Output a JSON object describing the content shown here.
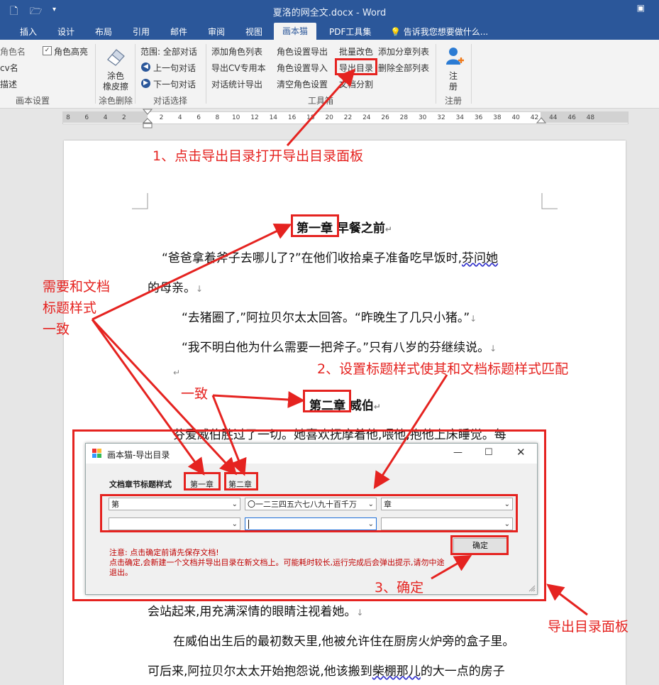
{
  "window": {
    "title": "夏洛的网全文.docx - Word",
    "quick_access": [
      "new-doc-icon",
      "open-folder-icon",
      "customize-icon"
    ]
  },
  "tabs": [
    {
      "label": "插入"
    },
    {
      "label": "设计"
    },
    {
      "label": "布局"
    },
    {
      "label": "引用"
    },
    {
      "label": "邮件"
    },
    {
      "label": "审阅"
    },
    {
      "label": "视图"
    },
    {
      "label": "画本猫",
      "active": true
    },
    {
      "label": "PDF工具集"
    }
  ],
  "tell_me": "告诉我您想要做什么...",
  "ribbon": {
    "g1": {
      "items": [
        "角色名",
        "cv名",
        "描述"
      ],
      "label": "画本设置"
    },
    "g2": {
      "role_highlight": "角色高亮",
      "role_highlight_checked": true
    },
    "g3": {
      "eraser_line1": "涂色",
      "eraser_line2": "橡皮擦",
      "label": "涂色删除"
    },
    "g4": {
      "scope": "范围: 全部对话",
      "prev": "上一句对话",
      "next": "下一句对话",
      "label": "对话选择"
    },
    "g5": {
      "col1": [
        "添加角色列表",
        "导出CV专用本",
        "对话统计导出"
      ],
      "col2": [
        "角色设置导出",
        "角色设置导入",
        "清空角色设置"
      ],
      "col3": [
        "批量改色",
        "导出目录",
        "文档分割"
      ],
      "col4": [
        "添加分章列表",
        "删除全部列表"
      ],
      "label": "工具箱"
    },
    "g6": {
      "line1": "注",
      "line2": "册",
      "label": "注册"
    }
  },
  "ruler": {
    "ticks": [
      "8",
      "6",
      "4",
      "2",
      "",
      "2",
      "4",
      "6",
      "8",
      "10",
      "12",
      "14",
      "16",
      "18",
      "20",
      "22",
      "24",
      "26",
      "28",
      "30",
      "32",
      "34",
      "36",
      "38",
      "40",
      "42",
      "44",
      "46",
      "48"
    ]
  },
  "document": {
    "ch1_num": "第一章",
    "ch1_title": "早餐之前",
    "p1a": "“爸爸拿着斧子去哪儿了?”在他们收拾桌子准备吃早饭时,",
    "p1b": "芬问她",
    "p1c": "的母亲。",
    "p2": "“去猪圈了,”阿拉贝尔太太回答。“昨晚生了几只小猪。”",
    "p3": "“我不明白他为什么需要一把斧子。”只有八岁的芬继续说。",
    "ch2_num": "第二章",
    "ch2_title": "威伯",
    "p4": "芬爱威伯胜过了一切。她喜欢抚摩着他,喂他,抱他上床睡觉。每",
    "p5": "会站起来,用充满深情的眼睛注视着她。",
    "p6": "在威伯出生后的最初数天里,他被允许住在厨房火炉旁的盒子里。",
    "p7a": "可后来,阿拉贝尔太太开始抱怨说,他该搬到",
    "p7b": "柴棚那儿",
    "p7c": "的大一点的房子",
    "pilcrow": "↵",
    "linebreak": "↓"
  },
  "dialog": {
    "title": "画本猫-导出目录",
    "style_label": "文档章节标题样式",
    "sample1": "第一章",
    "sample2": "第二章",
    "row1": [
      "第",
      "〇一二三四五六七八九十百千万",
      "章"
    ],
    "row2": [
      "",
      "",
      ""
    ],
    "notice1": "注意: 点击确定前请先保存文档!",
    "notice2": "点击确定,会新建一个文档并导出目录在新文档上。可能耗时较长,运行完成后会弹出提示,请勿中途",
    "notice3": "退出。",
    "ok": "确定"
  },
  "annotations": {
    "a1": "1、点击导出目录打开导出目录面板",
    "a2": "2、设置标题样式使其和文档标题样式匹配",
    "a3": "3、确定",
    "left1": "需要和文档",
    "left2": "标题样式",
    "left3": "一致",
    "consistent": "一致",
    "panel": "导出目录面板"
  },
  "colors": {
    "word_blue": "#2b579a",
    "annotation_red": "#e52320"
  }
}
